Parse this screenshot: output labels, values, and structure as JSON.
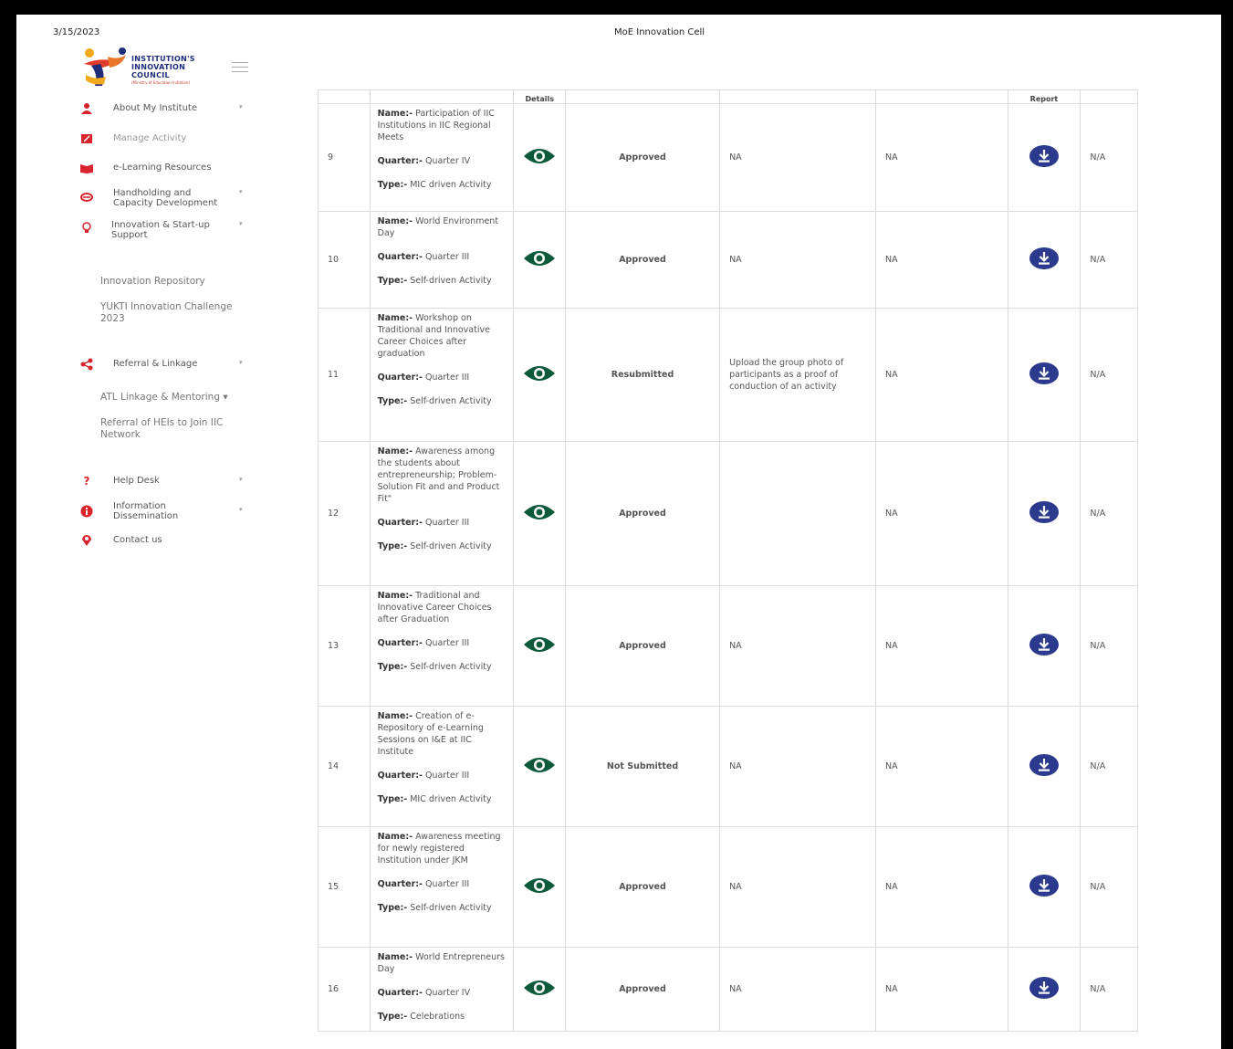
{
  "header": {
    "print_date": "3/15/2023",
    "print_title": "MoE Innovation Cell"
  },
  "logo": {
    "line1": "INSTITUTION'S",
    "line2": "INNOVATION",
    "line3": "COUNCIL",
    "tagline": "(Ministry of Education Initiative)"
  },
  "sidebar": {
    "items": [
      {
        "label": "About My Institute",
        "icon": "user-icon",
        "color": "#d9232d",
        "caret": true
      },
      {
        "label": "Manage Activity",
        "icon": "edit-icon",
        "color": "#d9232d",
        "caret": false
      },
      {
        "label": "e-Learning Resources",
        "icon": "book-icon",
        "color": "#d9232d",
        "caret": false
      },
      {
        "label": "Handholding and Capacity Development",
        "icon": "handshake-icon",
        "color": "#d9232d",
        "caret": true
      },
      {
        "label": "Innovation & Start-up Support",
        "icon": "bulb-icon",
        "color": "#d9232d",
        "caret": true
      },
      {
        "label": "Referral & Linkage",
        "icon": "share-icon",
        "color": "#d9232d",
        "caret": true
      },
      {
        "label": "Help Desk",
        "icon": "question-icon",
        "color": "#d9232d",
        "caret": true
      },
      {
        "label": "Information Dissemination",
        "icon": "info-icon",
        "color": "#d9232d",
        "caret": true
      },
      {
        "label": "Contact us",
        "icon": "location-icon",
        "color": "#d9232d",
        "caret": false
      }
    ],
    "subitems": {
      "innovation_repository": "Innovation Repository",
      "yukti_line1": "YUKTI Innovation Challenge",
      "yukti_line2": "2023",
      "atl": "ATL Linkage & Mentoring ▾",
      "referral_line1": "Referral of HEIs to Join IIC",
      "referral_line2": "Network"
    }
  },
  "table": {
    "headers": [
      "",
      "",
      "Details",
      "",
      "",
      "",
      "Report",
      ""
    ],
    "rows": [
      {
        "sn": "9",
        "name": "Participation of IIC Institutions in IIC Regional Meets",
        "quarter": "Quarter IV",
        "type": "MIC driven Activity",
        "status": "Approved",
        "remark": "NA",
        "col5": "NA",
        "col7": "N/A"
      },
      {
        "sn": "10",
        "name": "World Environment Day",
        "quarter": "Quarter III",
        "type": "Self-driven Activity",
        "status": "Approved",
        "remark": "NA",
        "col5": "NA",
        "col7": "N/A"
      },
      {
        "sn": "11",
        "name": "Workshop on Traditional and Innovative Career Choices after graduation",
        "quarter": "Quarter III",
        "type": "Self-driven Activity",
        "status": "Resubmitted",
        "remark": "Upload the group photo of participants as a proof of conduction of an activity",
        "col5": "NA",
        "col7": "N/A"
      },
      {
        "sn": "12",
        "name": "Awareness among the students about entrepreneurship; Problem-Solution Fit and and Product Fit\"",
        "quarter": "Quarter III",
        "type": "Self-driven Activity",
        "status": "Approved",
        "remark": "",
        "col5": "NA",
        "col7": "N/A"
      },
      {
        "sn": "13",
        "name": "Traditional and Innovative Career Choices after Graduation",
        "quarter": "Quarter III",
        "type": "Self-driven Activity",
        "status": "Approved",
        "remark": "NA",
        "col5": "NA",
        "col7": "N/A"
      },
      {
        "sn": "14",
        "name": "Creation of e-Repository of e-Learning Sessions on I&E at IIC Institute",
        "quarter": "Quarter III",
        "type": "MIC driven Activity",
        "status": "Not Submitted",
        "remark": "NA",
        "col5": "NA",
        "col7": "N/A"
      },
      {
        "sn": "15",
        "name": "Awareness meeting for newly registered Institution under JKM",
        "quarter": "Quarter III",
        "type": "Self-driven Activity",
        "status": "Approved",
        "remark": "NA",
        "col5": "NA",
        "col7": "N/A"
      },
      {
        "sn": "16",
        "name": "World Entrepreneurs Day",
        "quarter": "Quarter IV",
        "type": "Celebrations",
        "status": "Approved",
        "remark": "NA",
        "col5": "NA",
        "col7": "N/A"
      }
    ],
    "labels": {
      "name": "Name:-",
      "quarter": "Quarter:-",
      "type": "Type:-"
    }
  },
  "colors": {
    "approved": "#2e8b22",
    "not_submitted": "#e02020",
    "eye": "#0d5a3a",
    "download": "#2b3a8c",
    "accent": "#d9232d"
  }
}
